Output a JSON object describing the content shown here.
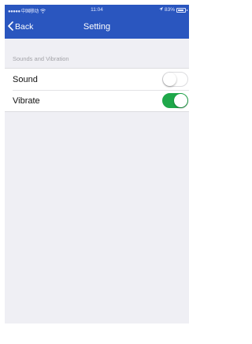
{
  "status_bar": {
    "carrier": "●●●●● 中国移动",
    "wifi_icon": "wifi-icon",
    "time": "11:04",
    "location_icon": "location-arrow-icon",
    "battery_percent_text": "83%",
    "battery_level": 0.83
  },
  "nav": {
    "back_label": "Back",
    "back_icon": "chevron-left-icon",
    "title": "Setting"
  },
  "section": {
    "header": "Sounds and Vibration"
  },
  "settings": [
    {
      "label": "Sound",
      "enabled": false
    },
    {
      "label": "Vibrate",
      "enabled": true
    }
  ],
  "colors": {
    "nav_background": "#2a56bf",
    "toggle_on": "#1fa84a",
    "background": "#efeff4"
  }
}
